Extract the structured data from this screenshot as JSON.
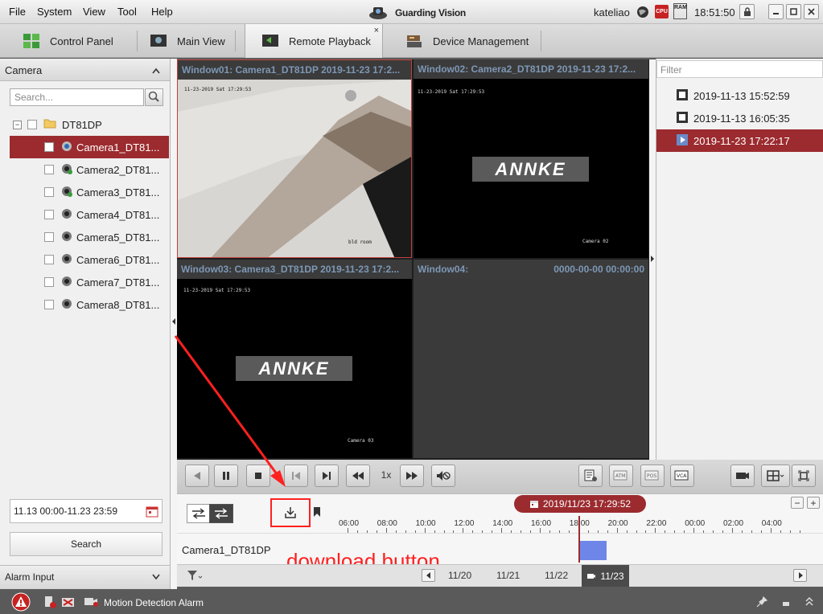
{
  "menu": {
    "file": "File",
    "system": "System",
    "view": "View",
    "tool": "Tool",
    "help": "Help"
  },
  "app": {
    "title": "Guarding Vision",
    "user": "kateliao",
    "clock": "18:51:50",
    "cpu_label": "CPU",
    "ram_label": "RAM"
  },
  "tabs": [
    {
      "label": "Control Panel"
    },
    {
      "label": "Main View"
    },
    {
      "label": "Remote Playback",
      "close": "×"
    },
    {
      "label": "Device Management"
    }
  ],
  "left": {
    "header": "Camera",
    "search_placeholder": "Search...",
    "group": "DT81DP",
    "cameras": [
      "Camera1_DT81...",
      "Camera2_DT81...",
      "Camera3_DT81...",
      "Camera4_DT81...",
      "Camera5_DT81...",
      "Camera6_DT81...",
      "Camera7_DT81...",
      "Camera8_DT81..."
    ],
    "date_range": "11.13 00:00-11.23 23:59",
    "search_button": "Search",
    "alarm_input": "Alarm Input"
  },
  "windows": [
    {
      "title": "Window01: Camera1_DT81DP  2019-11-23 17:2...",
      "osd_time": "11-23-2019 Sat 17:29:53",
      "osd_cam": "bld room"
    },
    {
      "title": "Window02: Camera2_DT81DP  2019-11-23 17:2...",
      "osd_time": "11-23-2019 Sat 17:29:53",
      "osd_cam": "Camera 02",
      "logo": "ANNKE"
    },
    {
      "title": "Window03: Camera3_DT81DP  2019-11-23 17:2...",
      "osd_time": "11-23-2019 Sat 17:29:53",
      "osd_cam": "Camera 03",
      "logo": "ANNKE"
    },
    {
      "title": "Window04:",
      "timestamp": "0000-00-00 00:00:00"
    }
  ],
  "right": {
    "filter_placeholder": "Filter",
    "records": [
      "2019-11-13 15:52:59",
      "2019-11-13 16:05:35",
      "2019-11-23 17:22:17"
    ]
  },
  "controls": {
    "speed": "1x"
  },
  "timeline": {
    "current": "2019/11/23 17:29:52",
    "hours": [
      "06:00",
      "08:00",
      "10:00",
      "12:00",
      "14:00",
      "16:00",
      "18:00",
      "20:00",
      "22:00",
      "00:00",
      "02:00",
      "04:00"
    ],
    "track_name": "Camera1_DT81DP",
    "annotation": "download button",
    "zoom_minus": "−",
    "zoom_plus": "+"
  },
  "dates": [
    "11/20",
    "11/21",
    "11/22",
    "11/23"
  ],
  "status": {
    "alarm_text": "Motion Detection Alarm"
  },
  "colors": {
    "accent": "#9b2b2f",
    "annotation": "#ff2020",
    "record_block": "#6e86e8"
  }
}
